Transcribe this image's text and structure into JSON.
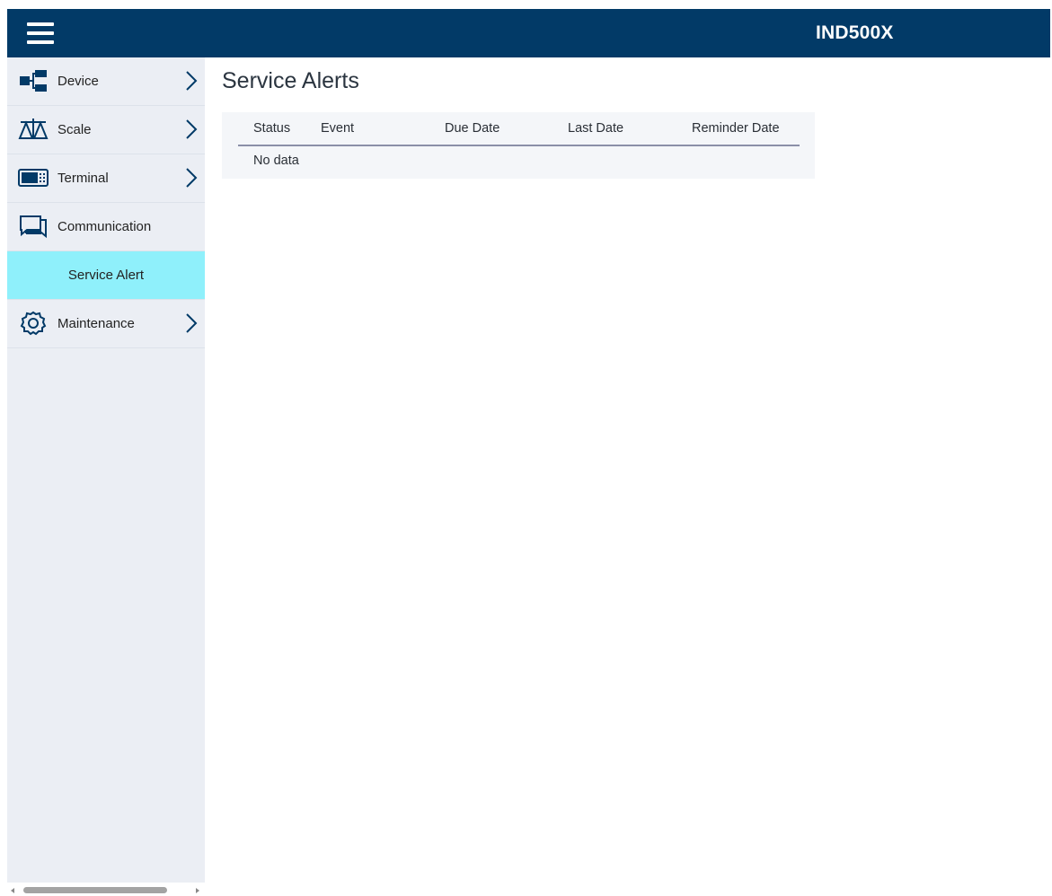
{
  "header": {
    "brand": "IND500X",
    "menu_icon": "hamburger-menu-icon",
    "bg_color": "#023a67"
  },
  "sidebar": {
    "items": [
      {
        "label": "Device",
        "icon": "device-network-icon",
        "has_chevron": true
      },
      {
        "label": "Scale",
        "icon": "scale-balance-icon",
        "has_chevron": true
      },
      {
        "label": "Terminal",
        "icon": "terminal-icon",
        "has_chevron": true
      },
      {
        "label": "Communication",
        "icon": "chat-icon",
        "has_chevron": false
      }
    ],
    "active_sub": {
      "label": "Service Alert",
      "highlight_color": "#8ff0fb"
    },
    "items_after": [
      {
        "label": "Maintenance",
        "icon": "gear-icon",
        "has_chevron": true
      }
    ]
  },
  "main": {
    "title": "Service Alerts",
    "table": {
      "columns": [
        "Status",
        "Event",
        "Due Date",
        "Last Date",
        "Reminder Date"
      ],
      "empty_text": "No data"
    }
  }
}
